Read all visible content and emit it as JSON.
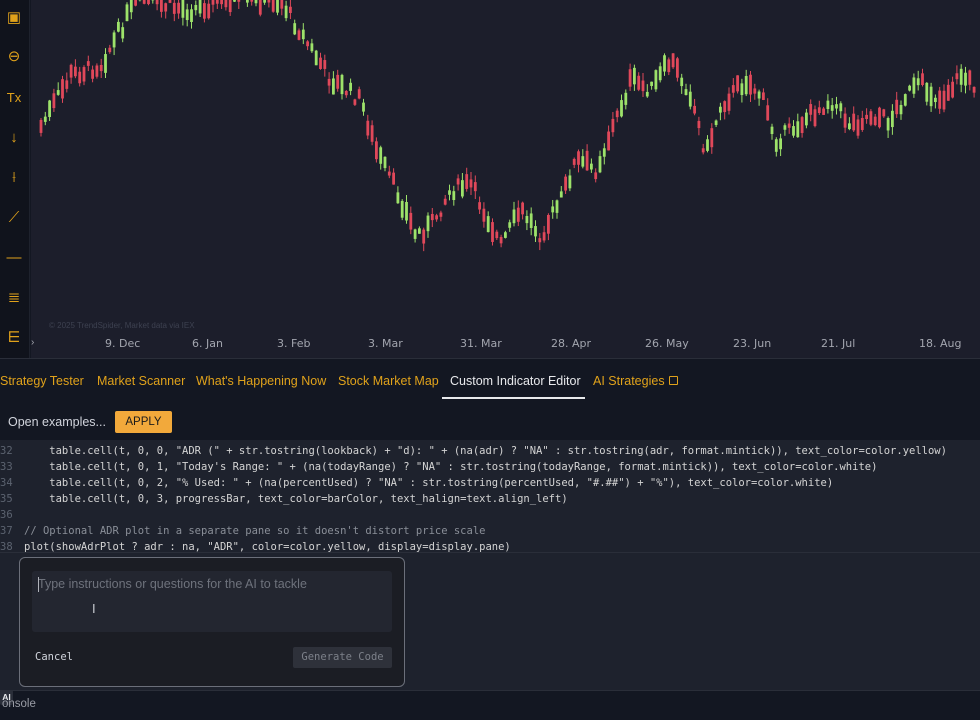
{
  "toolbar": {
    "tools": [
      "square-tool-icon",
      "crosshair-icon",
      "text-clear-icon",
      "arrow-down-icon",
      "vertical-line-icon",
      "trend-angle-icon",
      "horizontal-line-icon",
      "fib-retracement-icon",
      "gann-fan-icon"
    ]
  },
  "chart": {
    "watermark": "© 2025 TrendSpider, Market data via IEX",
    "date_labels": [
      "9. Dec",
      "6. Jan",
      "3. Feb",
      "3. Mar",
      "31. Mar",
      "28. Apr",
      "26. May",
      "23. Jun",
      "21. Jul",
      "18. Aug"
    ],
    "colors": {
      "up": "#9de26a",
      "down": "#e0485a",
      "background": "#1c1e2b"
    }
  },
  "tabs": {
    "items": [
      {
        "label": "Strategy Tester"
      },
      {
        "label": "Market Scanner"
      },
      {
        "label": "What's Happening Now"
      },
      {
        "label": "Stock Market Map"
      },
      {
        "label": "Custom Indicator Editor"
      },
      {
        "label": "AI Strategies"
      }
    ],
    "active": "Custom Indicator Editor"
  },
  "examples": {
    "label": "Open examples...",
    "apply_label": "APPLY"
  },
  "code": {
    "lines": [
      {
        "num": "32",
        "text": "    table.cell(t, 0, 0, \"ADR (\" + str.tostring(lookback) + \"d): \" + (na(adr) ? \"NA\" : str.tostring(adr, format.mintick)), text_color=color.yellow)"
      },
      {
        "num": "33",
        "text": "    table.cell(t, 0, 1, \"Today's Range: \" + (na(todayRange) ? \"NA\" : str.tostring(todayRange, format.mintick)), text_color=color.white)"
      },
      {
        "num": "34",
        "text": "    table.cell(t, 0, 2, \"% Used: \" + (na(percentUsed) ? \"NA\" : str.tostring(percentUsed, \"#.##\") + \"%\"), text_color=color.white)"
      },
      {
        "num": "35",
        "text": "    table.cell(t, 0, 3, progressBar, text_color=barColor, text_halign=text.align_left)"
      },
      {
        "num": "36",
        "text": ""
      },
      {
        "num": "37",
        "text": "// Optional ADR plot in a separate pane so it doesn't distort price scale"
      },
      {
        "num": "38",
        "text": "plot(showAdrPlot ? adr : na, \"ADR\", color=color.yellow, display=display.pane)"
      }
    ]
  },
  "ai_prompt": {
    "placeholder": "Type instructions or questions for the AI to tackle",
    "cancel_label": "Cancel",
    "generate_label": "Generate Code"
  },
  "bottom": {
    "ai_badge": "AI",
    "console_label": "onsole"
  }
}
